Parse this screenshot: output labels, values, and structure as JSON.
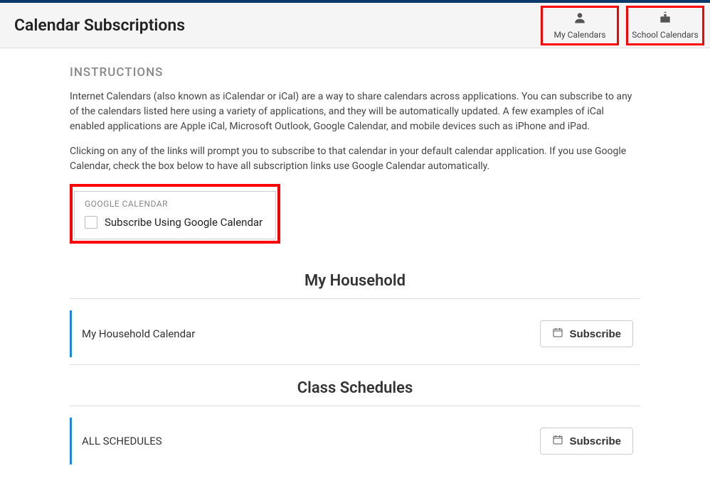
{
  "header": {
    "title": "Calendar Subscriptions",
    "nav": {
      "my_calendars": "My Calendars",
      "school_calendars": "School Calendars"
    }
  },
  "instructions": {
    "heading": "INSTRUCTIONS",
    "p1": "Internet Calendars (also known as iCalendar or iCal) are a way to share calendars across applications. You can subscribe to any of the calendars listed here using a variety of applications, and they will be automatically updated. A few examples of iCal enabled applications are Apple iCal, Microsoft Outlook, Google Calendar, and mobile devices such as iPhone and iPad.",
    "p2": "Clicking on any of the links will prompt you to subscribe to that calendar in your default calendar application. If you use Google Calendar, check the box below to have all subscription links use Google Calendar automatically."
  },
  "google": {
    "label": "GOOGLE CALENDAR",
    "checkbox_label": "Subscribe Using Google Calendar"
  },
  "sections": {
    "household": {
      "title": "My Household",
      "items": [
        {
          "name": "My Household Calendar",
          "button": "Subscribe"
        }
      ]
    },
    "class_schedules": {
      "title": "Class Schedules",
      "items": [
        {
          "name": "ALL SCHEDULES",
          "button": "Subscribe"
        }
      ]
    }
  }
}
